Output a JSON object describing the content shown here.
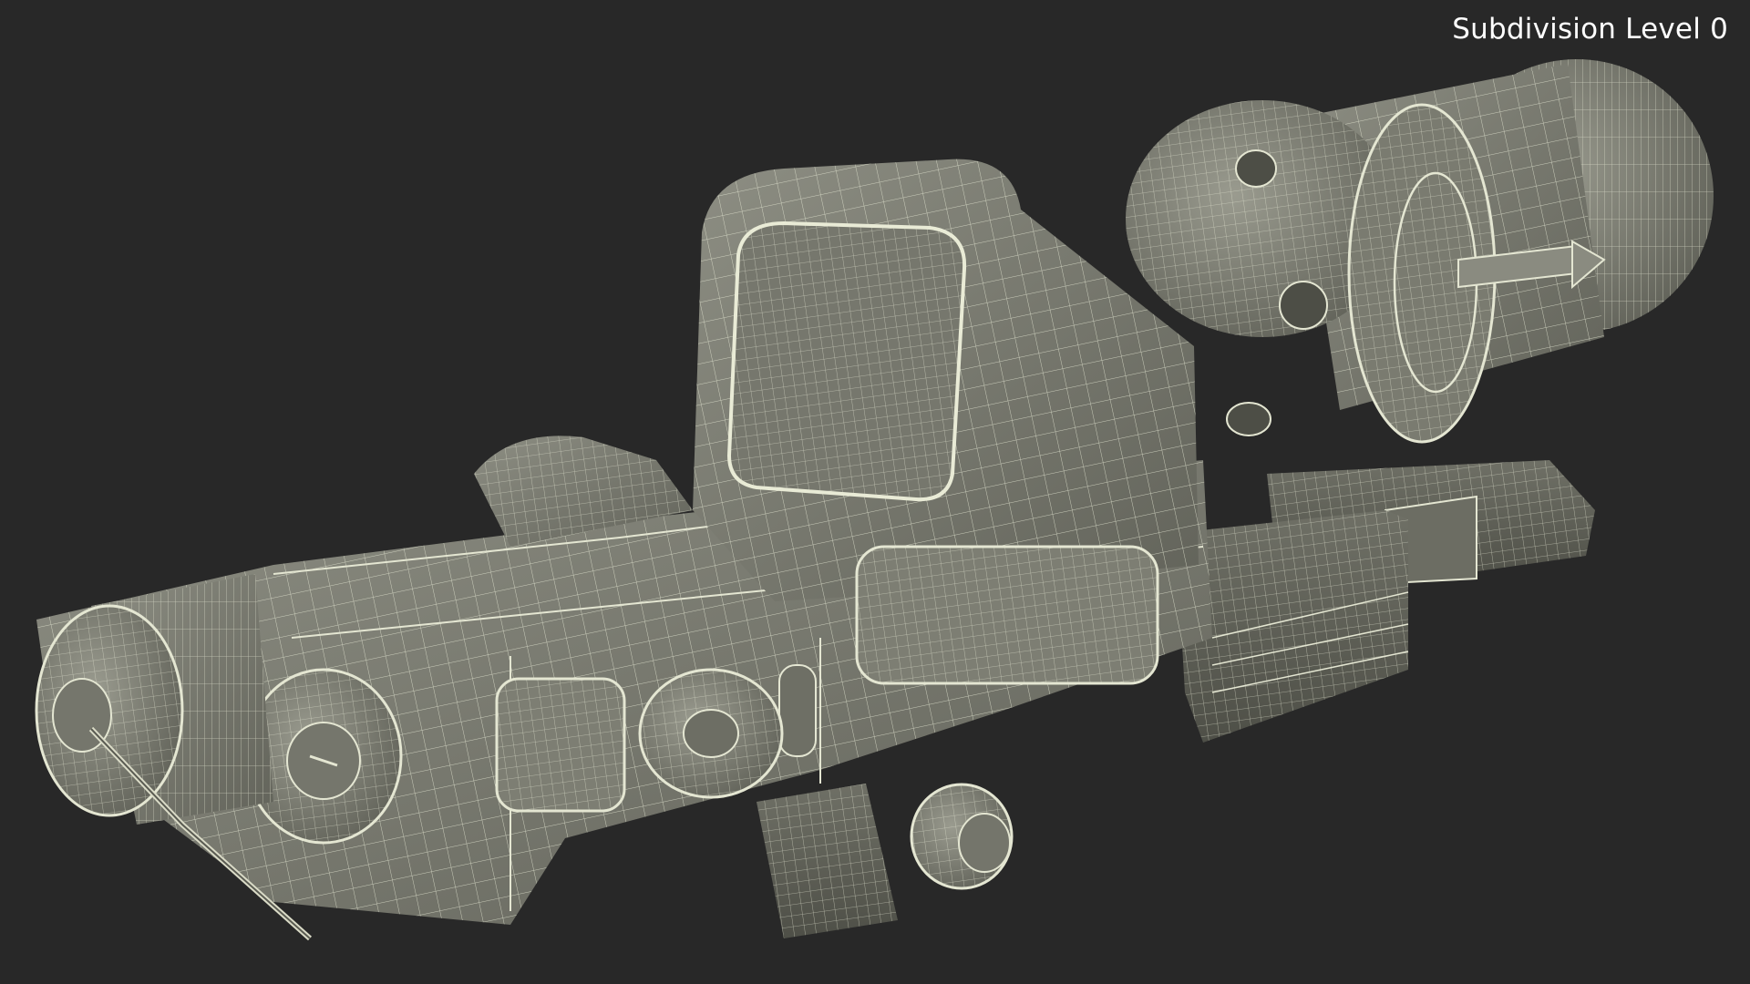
{
  "viewport": {
    "label": "Subdivision Level 0",
    "background": "#282828",
    "model_fill": "#84857a",
    "model_shade": "#6b6c62",
    "wire_color": "#e4e6d2"
  },
  "scene": {
    "subject": "holographic-sight-with-magnifier-wireframe"
  }
}
